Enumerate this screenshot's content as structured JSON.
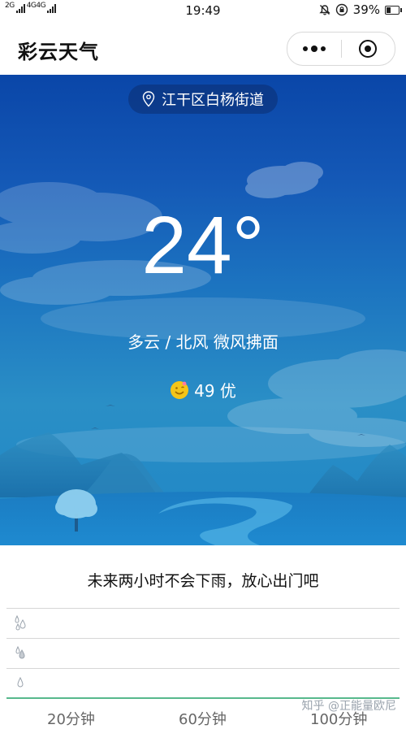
{
  "status_bar": {
    "left_text_1": "2G",
    "left_text_2": "4G4G",
    "time": "19:49",
    "battery": "39%",
    "battery_level": 0.39
  },
  "header": {
    "title": "彩云天气",
    "menu_icon": "more-dots-icon",
    "close_icon": "target-close-icon"
  },
  "weather": {
    "location": "江干区白杨街道",
    "temperature": "24°",
    "description": "多云 / 北风 微风拂面",
    "aqi": "49 优"
  },
  "forecast": {
    "message": "未来两小时不会下雨，放心出门吧",
    "time_labels": [
      "20分钟",
      "60分钟",
      "100分钟"
    ]
  },
  "watermark": "知乎 @正能量欧尼",
  "colors": {
    "sky_top": "#0a46a8",
    "sky_bottom": "#2a8fc6",
    "rain_line": "#57b98c"
  }
}
